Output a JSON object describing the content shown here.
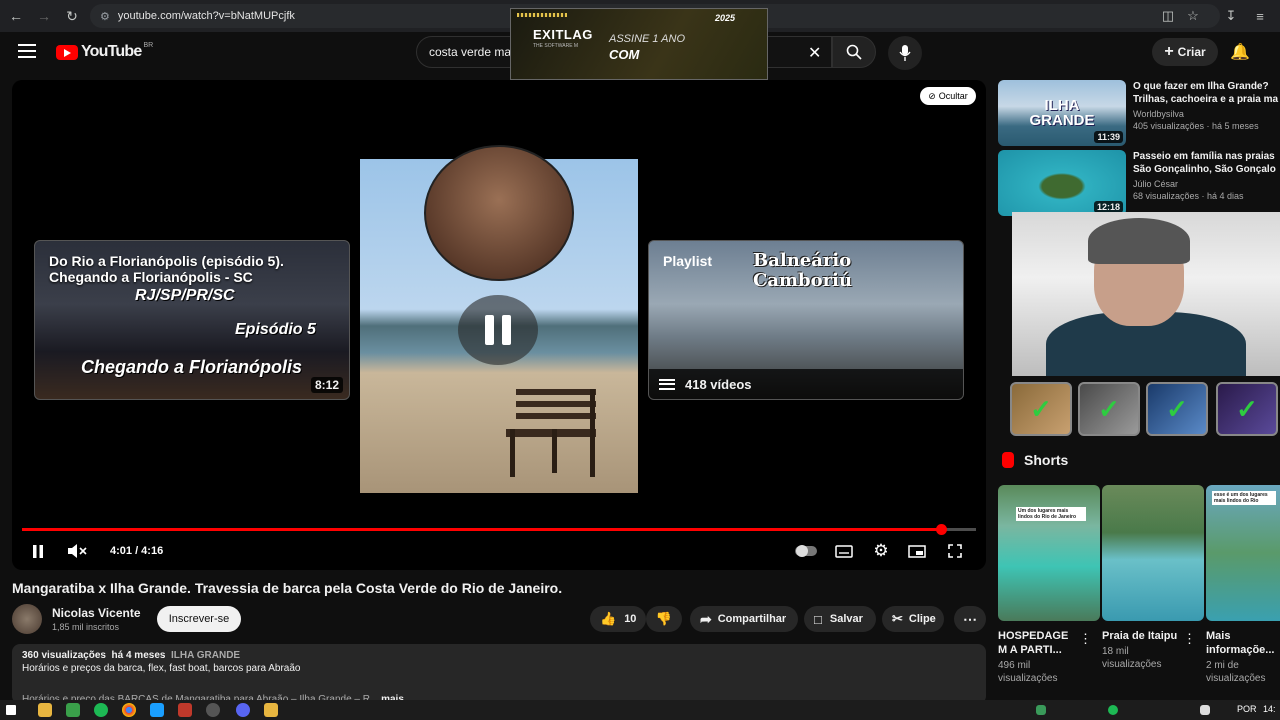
{
  "browser": {
    "url": "youtube.com/watch?v=bNatMUPcjfk"
  },
  "ad": {
    "brand": "EXITLAG",
    "tagline": "THE SOFTWARE M",
    "line1": "ASSINE 1 ANO",
    "line2": "COM",
    "year": "2025"
  },
  "header": {
    "logo": "YouTube",
    "region": "BR",
    "search_value": "costa verde ma",
    "create_label": "Criar"
  },
  "player": {
    "hide_label": "Ocultar",
    "endcard_left": {
      "title": "Do Rio a Florianópolis (episódio 5). Chegando a Florianópolis - SC",
      "overlay1": "RJ/SP/PR/SC",
      "overlay2": "Episódio 5",
      "overlay3": "Chegando a Florianópolis",
      "duration": "8:12"
    },
    "endcard_right": {
      "label": "Playlist",
      "city": "Balneário Camboriú",
      "count": "418 vídeos"
    },
    "time": "4:01 / 4:16",
    "progress": 0.9636
  },
  "video": {
    "title": "Mangaratiba x Ilha Grande. Travessia de barca pela Costa Verde do Rio de Janeiro.",
    "channel": "Nicolas Vicente",
    "subs": "1,85 mil inscritos",
    "subscribe_label": "Inscrever-se",
    "likes": "10",
    "share_label": "Compartilhar",
    "save_label": "Salvar",
    "clip_label": "Clipe",
    "views": "360 visualizações",
    "age": "há 4 meses",
    "tag": "ILHA GRANDE",
    "desc_line2": "Horários e preços da barca, flex, fast boat, barcos para Abraão",
    "desc_line3": "Horários e preço das BARCAS de Mangaratiba para Abraão – Ilha Grande – R...",
    "more_label": "mais"
  },
  "sidebar": {
    "videos": [
      {
        "title": "O que fazer em  Ilha Grande? Trilhas, cachoeira e a praia ma",
        "channel": "Worldbysilva",
        "meta": "405 visualizações · há 5 meses",
        "duration": "11:39",
        "thumb_text": "ILHA GRANDE"
      },
      {
        "title": "Passeio em família nas praias São Gonçalinho, São Gonçalo",
        "channel": "Júlio César",
        "meta": "68 visualizações · há 4 dias",
        "duration": "12:18"
      }
    ],
    "shorts_label": "Shorts",
    "shorts": [
      {
        "title": "HOSPEDAGE M A PARTI...",
        "views": "496 mil visualizações",
        "caption": "Um dos lugares mais lindos do Rio de Janeiro"
      },
      {
        "title": "Praia de Itaipu",
        "views": "18 mil visualizações"
      },
      {
        "title": "Mais informaçõe...",
        "views": "2 mi de visualizações",
        "caption": "esse é um dos lugares mais lindos do Rio"
      }
    ]
  },
  "taskbar": {
    "lang": "POR",
    "clock": "14:"
  }
}
